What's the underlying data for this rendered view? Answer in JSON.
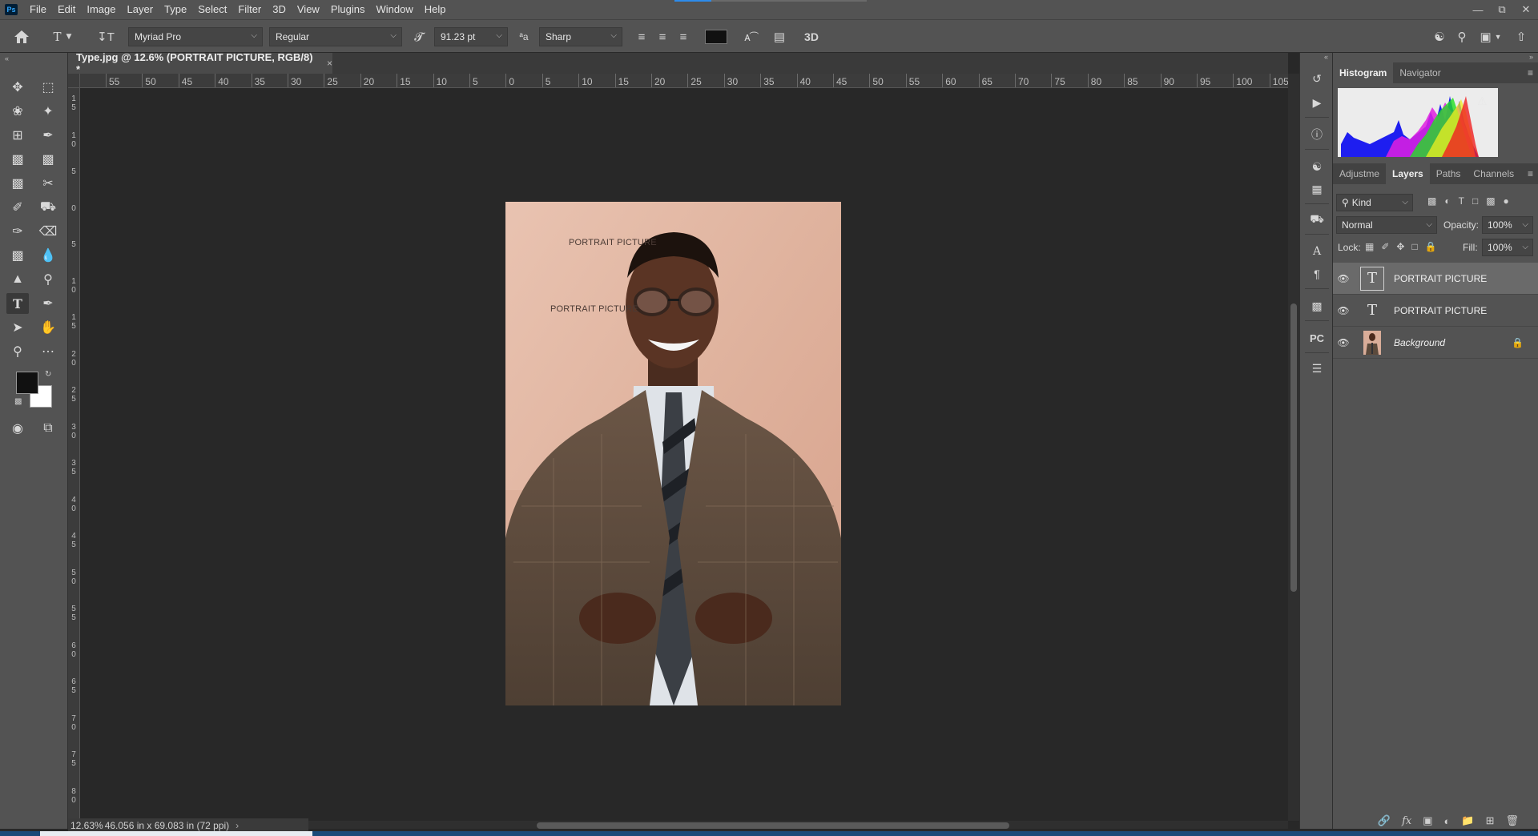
{
  "menubar": {
    "logo": "Ps",
    "items": [
      "File",
      "Edit",
      "Image",
      "Layer",
      "Type",
      "Select",
      "Filter",
      "3D",
      "View",
      "Plugins",
      "Window",
      "Help"
    ]
  },
  "options": {
    "font_family": "Myriad Pro",
    "font_style": "Regular",
    "font_size": "91.23 pt",
    "antialias_icon_text": "ªa",
    "antialias": "Sharp",
    "threed_label": "3D"
  },
  "document": {
    "tab_title": "Type.jpg @ 12.6% (PORTRAIT PICTURE, RGB/8) *",
    "close": "×"
  },
  "rulers": {
    "h_labels": [
      "55",
      "50",
      "45",
      "40",
      "35",
      "30",
      "25",
      "20",
      "15",
      "10",
      "5",
      "0",
      "5",
      "10",
      "15",
      "20",
      "25",
      "30",
      "35",
      "40",
      "45",
      "50",
      "55",
      "60",
      "65",
      "70",
      "75",
      "80",
      "85",
      "90",
      "95",
      "100",
      "105"
    ],
    "v_labels": [
      "1 5",
      "1 0",
      "5",
      "0",
      "5",
      "1 0",
      "1 5",
      "2 0",
      "2 5",
      "3 0",
      "3 5",
      "4 0",
      "4 5",
      "5 0",
      "5 5",
      "6 0",
      "6 5",
      "7 0",
      "7 5",
      "8 0"
    ]
  },
  "canvas": {
    "text_layer_1": "PORTRAIT PICTURE",
    "text_layer_2": "PORTRAIT PICTURE"
  },
  "status": {
    "zoom": "12.63%",
    "doc_size": "46.056 in x 69.083 in (72 ppi)",
    "arrow": "›"
  },
  "panels": {
    "top_tabs": [
      "Histogram",
      "Navigator"
    ],
    "layer_tabs": [
      "Adjustme",
      "Layers",
      "Paths",
      "Channels"
    ],
    "filter_kind": "Kind",
    "blend_mode": "Normal",
    "opacity_label": "Opacity:",
    "opacity_value": "100%",
    "lock_label": "Lock:",
    "fill_label": "Fill:",
    "fill_value": "100%",
    "layers": [
      {
        "name": "PORTRAIT PICTURE",
        "type": "text",
        "selected": true
      },
      {
        "name": "PORTRAIT PICTURE",
        "type": "text",
        "selected": false
      },
      {
        "name": "Background",
        "type": "image",
        "locked": true
      }
    ],
    "pc_label": "PC"
  },
  "colors": {
    "ui_bg": "#535353",
    "canvas_bg": "#282828",
    "accent": "#31a8ff"
  }
}
